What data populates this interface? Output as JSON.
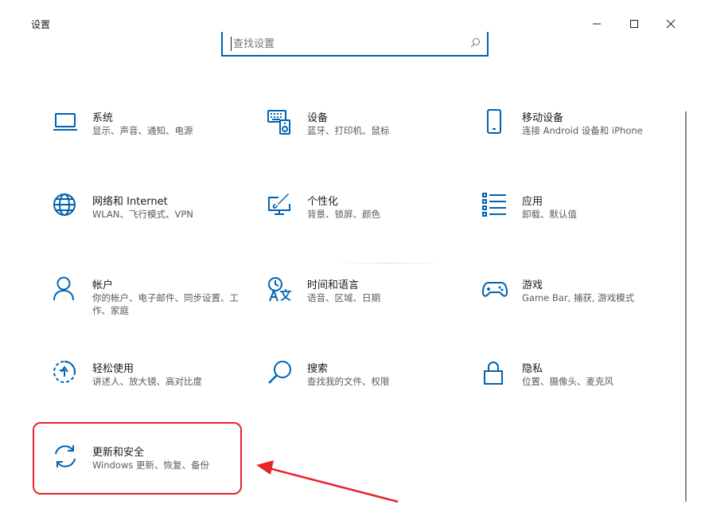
{
  "window": {
    "title": "设置",
    "controls": [
      "minimize-icon",
      "maximize-icon",
      "close-icon"
    ]
  },
  "search": {
    "placeholder": "查找设置",
    "icon": "search-icon"
  },
  "colors": {
    "accent": "#0063b1",
    "highlight": "#e8242b"
  },
  "tiles": [
    {
      "name": "系统",
      "desc": "显示、声音、通知、电源",
      "icon": "laptop-icon"
    },
    {
      "name": "设备",
      "desc": "蓝牙、打印机、鼠标",
      "icon": "keyboard-speaker-icon"
    },
    {
      "name": "移动设备",
      "desc": "连接 Android 设备和 iPhone",
      "icon": "phone-icon"
    },
    {
      "name": "网络和 Internet",
      "desc": "WLAN、飞行模式、VPN",
      "icon": "globe-icon"
    },
    {
      "name": "个性化",
      "desc": "背景、锁屏、颜色",
      "icon": "paint-monitor-icon"
    },
    {
      "name": "应用",
      "desc": "卸载、默认值",
      "icon": "app-list-icon"
    },
    {
      "name": "帐户",
      "desc": "你的帐户、电子邮件、同步设置、工作、家庭",
      "icon": "person-icon"
    },
    {
      "name": "时间和语言",
      "desc": "语音、区域、日期",
      "icon": "time-language-icon"
    },
    {
      "name": "游戏",
      "desc": "Game Bar, 捕获, 游戏模式",
      "icon": "gamepad-icon"
    },
    {
      "name": "轻松使用",
      "desc": "讲述人、放大镜、高对比度",
      "icon": "ease-of-access-icon"
    },
    {
      "name": "搜索",
      "desc": "查找我的文件、权限",
      "icon": "search-magnifier-icon"
    },
    {
      "name": "隐私",
      "desc": "位置、摄像头、麦克风",
      "icon": "lock-icon"
    },
    {
      "name": "更新和安全",
      "desc": "Windows 更新、恢复、备份",
      "icon": "sync-icon"
    }
  ]
}
